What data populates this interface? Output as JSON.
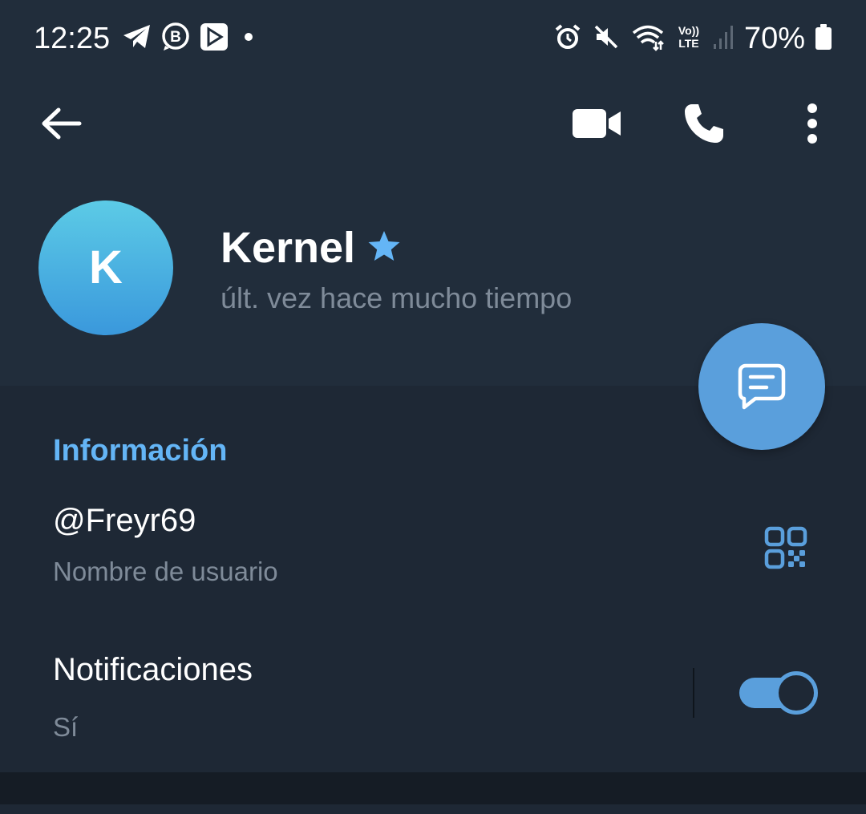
{
  "status_bar": {
    "time": "12:25",
    "battery_percent": "70%",
    "network_label_top": "Vo))",
    "network_label_bottom": "LTE"
  },
  "app_bar": {
    "icons": [
      "back-arrow-icon",
      "video-call-icon",
      "phone-icon",
      "more-vert-icon"
    ]
  },
  "profile": {
    "avatar_letter": "K",
    "name": "Kernel",
    "last_seen": "últ. vez hace mucho tiempo"
  },
  "info": {
    "section_title": "Información",
    "username_value": "@Freyr69",
    "username_caption": "Nombre de usuario",
    "notifications_label": "Notificaciones",
    "notifications_value": "Sí",
    "notifications_enabled": true
  },
  "colors": {
    "header_bg": "#212d3b",
    "section_bg": "#1e2835",
    "accent": "#5a9fdc",
    "section_title": "#64b5f6",
    "secondary_text": "#7f8b99"
  }
}
